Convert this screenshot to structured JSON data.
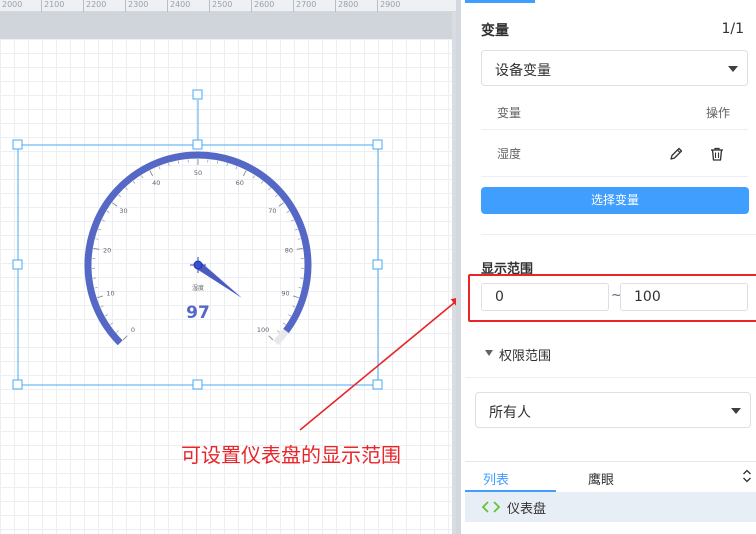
{
  "ruler": {
    "labels": [
      "2000",
      "2100",
      "2200",
      "2300",
      "2400",
      "2500",
      "2600",
      "2700",
      "2800",
      "2900"
    ]
  },
  "gauge": {
    "variable_name": "湿度",
    "value": 97,
    "min": 0,
    "max": 100,
    "tick_labels": [
      "0",
      "10",
      "20",
      "30",
      "40",
      "50",
      "60",
      "70",
      "80",
      "90",
      "100"
    ],
    "colors": {
      "arc": "#5568c6",
      "needle": "#4a5bc2",
      "value_text": "#5568c6",
      "tick": "#7f8794"
    }
  },
  "annotation": {
    "text": "可设置仪表盘的显示范围",
    "color": "#e8262a"
  },
  "panel": {
    "variable_section": {
      "title": "变量",
      "page_indicator": "1/1",
      "source_select": {
        "value": "设备变量"
      },
      "table": {
        "columns": [
          "变量",
          "操作"
        ],
        "rows": [
          {
            "name": "湿度",
            "actions": [
              "edit-icon",
              "delete-icon"
            ]
          }
        ]
      },
      "select_button": "选择变量"
    },
    "display_range": {
      "title": "显示范围",
      "min": "0",
      "separator": "~",
      "max": "100"
    },
    "permission": {
      "toggle_label": "权限范围",
      "owner_select": {
        "value": "所有人"
      }
    },
    "bottom_tabs": {
      "tabs": [
        "列表",
        "鹰眼"
      ],
      "active": "列表"
    },
    "tree": {
      "item_label": "仪表盘"
    }
  },
  "colors": {
    "primary": "#409eff",
    "highlight": "#e8262a",
    "selection": "#4aa8f0"
  }
}
